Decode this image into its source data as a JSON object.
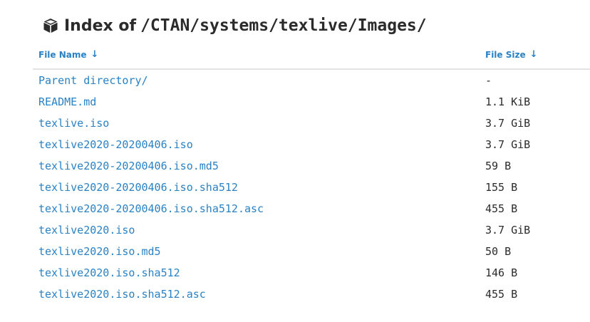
{
  "header": {
    "icon": "cube-icon",
    "title_prefix": "Index of",
    "title_path": "/CTAN/systems/texlive/Images/"
  },
  "columns": {
    "name_label": "File Name",
    "name_sort_icon": "arrow-down-icon",
    "name_sort_glyph": "↓",
    "size_label": "File Size",
    "size_sort_icon": "arrow-down-icon",
    "size_sort_glyph": "↓"
  },
  "colors": {
    "link": "#2a82c4",
    "text": "#2b2b2b",
    "divider": "#e3e3e3"
  },
  "files": [
    {
      "name": "Parent directory/",
      "size": "-"
    },
    {
      "name": "README.md",
      "size": "1.1 KiB"
    },
    {
      "name": "texlive.iso",
      "size": "3.7 GiB"
    },
    {
      "name": "texlive2020-20200406.iso",
      "size": "3.7 GiB"
    },
    {
      "name": "texlive2020-20200406.iso.md5",
      "size": "59 B"
    },
    {
      "name": "texlive2020-20200406.iso.sha512",
      "size": "155 B"
    },
    {
      "name": "texlive2020-20200406.iso.sha512.asc",
      "size": "455 B"
    },
    {
      "name": "texlive2020.iso",
      "size": "3.7 GiB"
    },
    {
      "name": "texlive2020.iso.md5",
      "size": "50 B"
    },
    {
      "name": "texlive2020.iso.sha512",
      "size": "146 B"
    },
    {
      "name": "texlive2020.iso.sha512.asc",
      "size": "455 B"
    }
  ]
}
